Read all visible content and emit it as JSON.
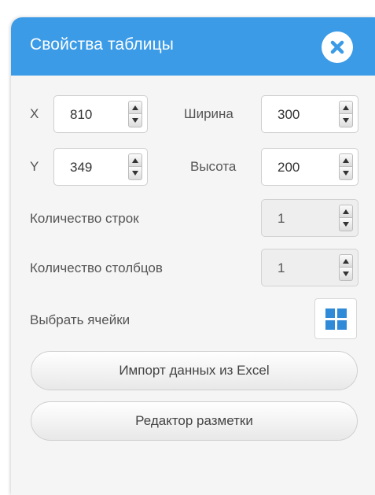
{
  "header": {
    "title": "Свойства таблицы",
    "close_icon": "close-icon"
  },
  "fields": {
    "x": {
      "label": "X",
      "value": "810"
    },
    "y": {
      "label": "Y",
      "value": "349"
    },
    "width": {
      "label": "Ширина",
      "value": "300"
    },
    "height": {
      "label": "Высота",
      "value": "200"
    },
    "rows": {
      "label": "Количество строк",
      "value": "1",
      "disabled": true
    },
    "cols": {
      "label": "Количество столбцов",
      "value": "1",
      "disabled": true
    }
  },
  "select_cells": {
    "label": "Выбрать ячейки",
    "icon": "grid-icon",
    "icon_color": "#2f8ad8"
  },
  "buttons": {
    "import_excel": "Импорт данных из Excel",
    "markup_editor": "Редактор разметки"
  },
  "colors": {
    "accent": "#3b9be6",
    "panel_bg": "#f5f5f5"
  }
}
